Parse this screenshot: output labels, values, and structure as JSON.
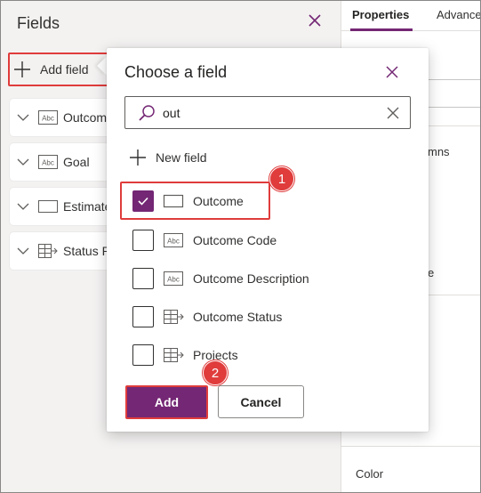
{
  "fields_pane": {
    "title": "Fields",
    "add_field_label": "Add field",
    "fields": [
      {
        "label": "Outcome",
        "icon": "text-field-icon"
      },
      {
        "label": "Goal",
        "icon": "text-field-icon"
      },
      {
        "label": "Estimated",
        "icon": "rectangle-field-icon"
      },
      {
        "label": "Status R",
        "icon": "choice-field-icon"
      }
    ]
  },
  "properties_pane": {
    "tabs": [
      {
        "label": "Properties",
        "active": true
      },
      {
        "label": "Advanced",
        "active": false
      }
    ],
    "partial_labels": {
      "columns": "mns",
      "e_label": "e",
      "color": "Color"
    }
  },
  "popup": {
    "title": "Choose a field",
    "search": {
      "value": "out",
      "placeholder": ""
    },
    "new_field_label": "New field",
    "options": [
      {
        "label": "Outcome",
        "checked": true,
        "icon": "rectangle-field-icon"
      },
      {
        "label": "Outcome Code",
        "checked": false,
        "icon": "text-field-icon"
      },
      {
        "label": "Outcome Description",
        "checked": false,
        "icon": "text-field-icon"
      },
      {
        "label": "Outcome Status",
        "checked": false,
        "icon": "choice-field-icon"
      },
      {
        "label": "Projects",
        "checked": false,
        "icon": "choice-field-icon"
      }
    ],
    "add_button": "Add",
    "cancel_button": "Cancel"
  },
  "annotations": {
    "badge_1": "1",
    "badge_2": "2"
  },
  "colors": {
    "accent": "#742774",
    "highlight": "#e03c3c",
    "pane_bg": "#f3f2f1"
  }
}
